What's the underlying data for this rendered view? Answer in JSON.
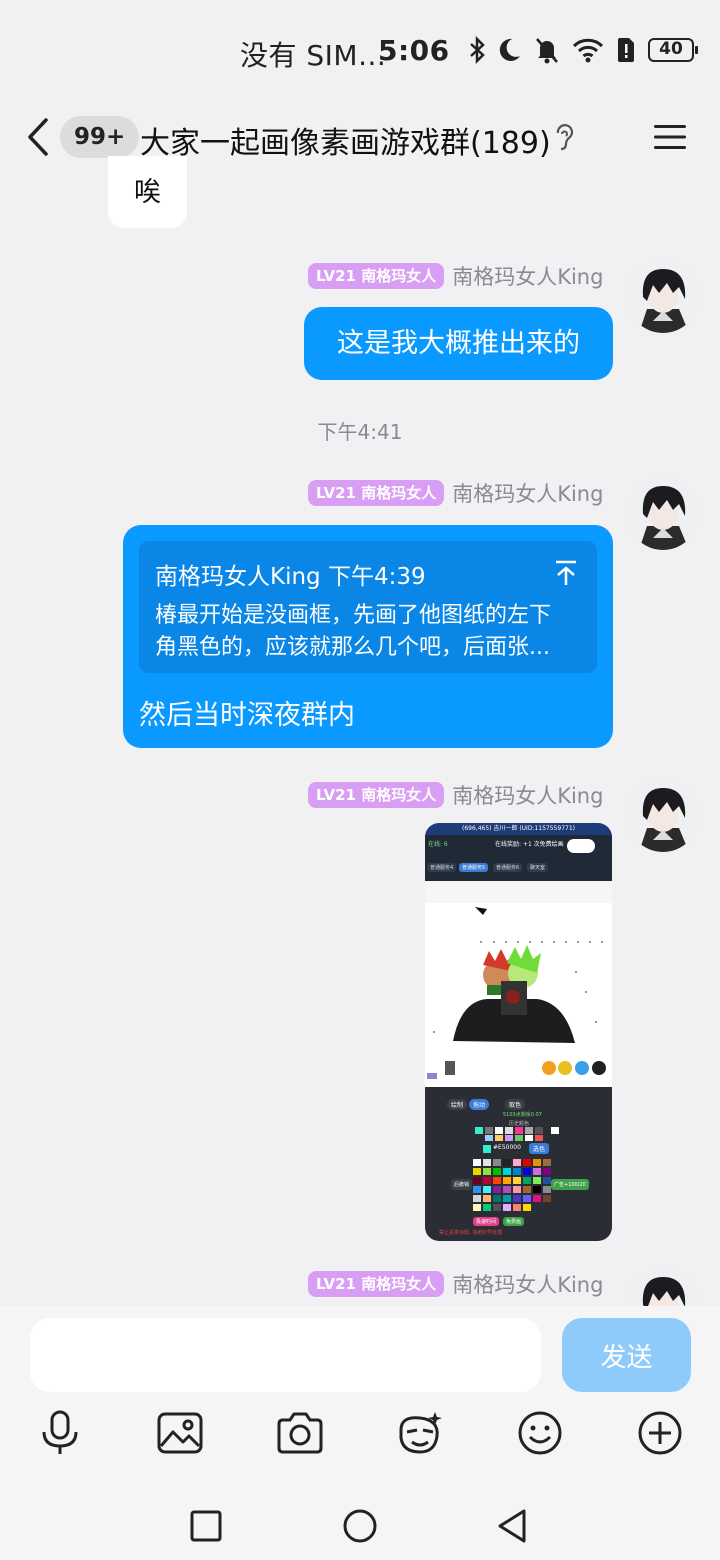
{
  "status": {
    "sim": "没有 SIM...",
    "time": "5:06",
    "battery": "40"
  },
  "header": {
    "unread": "99+",
    "title": "大家一起画像素画游戏群(189)"
  },
  "messages": {
    "partial_text": "唉",
    "sender_badge": "LV21 南格玛女人",
    "sender_name": "南格玛女人King",
    "msg1": "这是我大概推出来的",
    "time_sep": "下午4:41",
    "quote_meta": "南格玛女人King 下午4:39",
    "quote_line1": "椿最开始是没画框，先画了他图纸的左下",
    "quote_line2": "角黑色的，应该就那么几个吧，后面张...",
    "msg2": "然后当时深夜群内"
  },
  "game_screenshot": {
    "coords": "(696,465) 吉川一郎 (UID:1157559771)",
    "online": "在线: 6",
    "reward": "在线奖励: +1 次免费绘画",
    "tab1": "普通服务4",
    "tab2": "普通服务5",
    "tab3": "普通服务6",
    "tab4": "聊天室",
    "tool_draw": "绘制",
    "tool_move": "拖动",
    "tool_color": "取色",
    "remaining": "5103点剩余0.07",
    "history": "历史颜色",
    "hex": "#E50000",
    "pick": "选色",
    "undo": "后撤销",
    "ad": "广告+100/20",
    "btn_fast": "极速时间",
    "btn_free": "免费画",
    "footer": "禁止恶意涂鸦, 违者封号处理"
  },
  "input": {
    "placeholder": "",
    "send": "发送"
  },
  "toolbar_icons": [
    "mic-icon",
    "image-icon",
    "camera-icon",
    "sticker-icon",
    "emoji-icon",
    "plus-icon"
  ],
  "colors": {
    "bubble": "#0a99ff",
    "badge": "#d89ef3",
    "send": "#8ecafa"
  }
}
